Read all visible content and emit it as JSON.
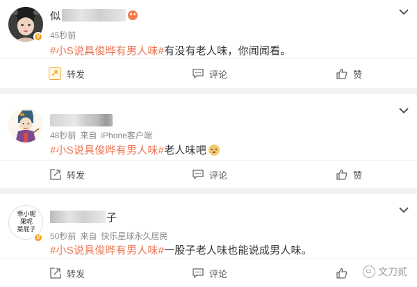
{
  "posts": [
    {
      "name_visible": "似",
      "time": "45秒前",
      "source_prefix": "",
      "source": "",
      "topic": "#小S说具俊晔有男人味#",
      "text": "有没有老人味，你闻闻看。",
      "actions": {
        "repost": "转发",
        "comment": "评论",
        "like": "赞"
      }
    },
    {
      "name_visible": "",
      "time": "48秒前",
      "source_prefix": "来自",
      "source": "iPhone客户端",
      "topic": "#小S说具俊晔有男人味#",
      "text": "老人味吧",
      "actions": {
        "repost": "转发",
        "comment": "评论",
        "like": "赞"
      }
    },
    {
      "name_visible": "子",
      "time": "50秒前",
      "source_prefix": "来自",
      "source": "快乐星球永久居民",
      "topic": "#小S说具俊晔有男人味#",
      "text": "一股子老人味也能说成男人味。",
      "actions": {
        "repost": "转发",
        "comment": "评论",
        "like": ""
      }
    }
  ],
  "avatar3_text": [
    "乖小呢",
    "果呢",
    "菜屁子"
  ],
  "watermark": "文刀贰",
  "colors": {
    "topic": "#eb7350",
    "meta": "#8a8a8a",
    "badge": "#f6a623"
  }
}
